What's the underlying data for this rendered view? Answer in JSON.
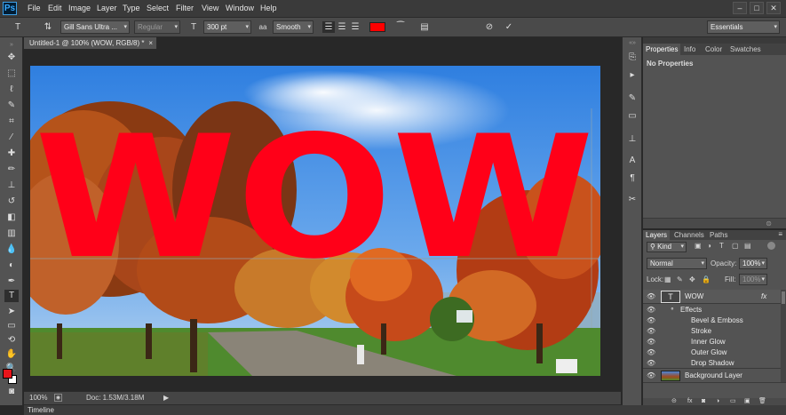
{
  "app": {
    "logo": "Ps"
  },
  "menu": [
    "File",
    "Edit",
    "Image",
    "Layer",
    "Type",
    "Select",
    "Filter",
    "View",
    "Window",
    "Help"
  ],
  "window_controls": [
    "–",
    "□",
    "✕"
  ],
  "options_bar": {
    "font_family": "Gill Sans Ultra ...",
    "font_style": "Regular",
    "font_size": "300 pt",
    "aa_label": "aa",
    "antialias": "Smooth",
    "text_color": "#ff0000",
    "workspace": "Essentials"
  },
  "document": {
    "tab_title": "Untitled-1 @ 100% (WOW, RGB/8) *",
    "tab_close": "×",
    "text": "WOW",
    "text_color": "#ff0018"
  },
  "status": {
    "zoom": "100%",
    "doc": "Doc: 1.53M/3.18M"
  },
  "timeline": {
    "label": "Timeline"
  },
  "panels": {
    "top_tabs": [
      "Properties",
      "Info",
      "Color",
      "Swatches"
    ],
    "properties_text": "No Properties",
    "layer_tabs": [
      "Layers",
      "Channels",
      "Paths"
    ],
    "kind": "Kind",
    "blend_mode": "Normal",
    "opacity_label": "Opacity:",
    "opacity": "100%",
    "lock_label": "Lock:",
    "fill_label": "Fill:",
    "fill": "100%",
    "layers": [
      {
        "name": "WOW",
        "type": "text",
        "fx": "fx"
      },
      {
        "name": "Effects",
        "type": "effects-header"
      },
      {
        "name": "Bevel & Emboss",
        "type": "effect"
      },
      {
        "name": "Stroke",
        "type": "effect"
      },
      {
        "name": "Inner Glow",
        "type": "effect"
      },
      {
        "name": "Outer Glow",
        "type": "effect"
      },
      {
        "name": "Drop Shadow",
        "type": "effect"
      },
      {
        "name": "Background Layer",
        "type": "image"
      }
    ]
  }
}
